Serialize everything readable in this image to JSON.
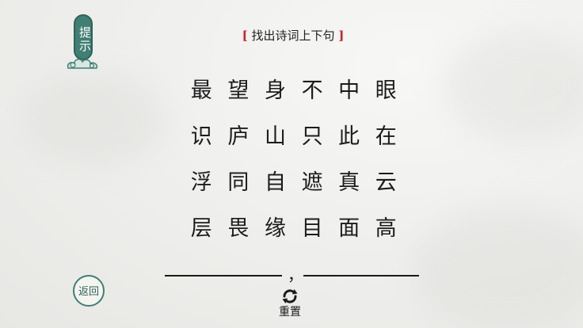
{
  "hint": {
    "label": "提示"
  },
  "title": {
    "open_bracket": "[",
    "text": "找出诗词上下句",
    "close_bracket": "]"
  },
  "grid": {
    "rows": [
      [
        "最",
        "望",
        "身",
        "不",
        "中",
        "眼"
      ],
      [
        "识",
        "庐",
        "山",
        "只",
        "此",
        "在"
      ],
      [
        "浮",
        "同",
        "自",
        "遮",
        "真",
        "云"
      ],
      [
        "层",
        "畏",
        "缘",
        "目",
        "面",
        "高"
      ]
    ]
  },
  "answer": {
    "separator": "，"
  },
  "controls": {
    "reset_label": "重置",
    "back_label": "返回"
  },
  "colors": {
    "accent_green": "#3f7f74",
    "bracket_red": "#c0262d"
  },
  "icons": {
    "reset": "refresh-icon",
    "hint_decoration": "cloud-icon"
  }
}
